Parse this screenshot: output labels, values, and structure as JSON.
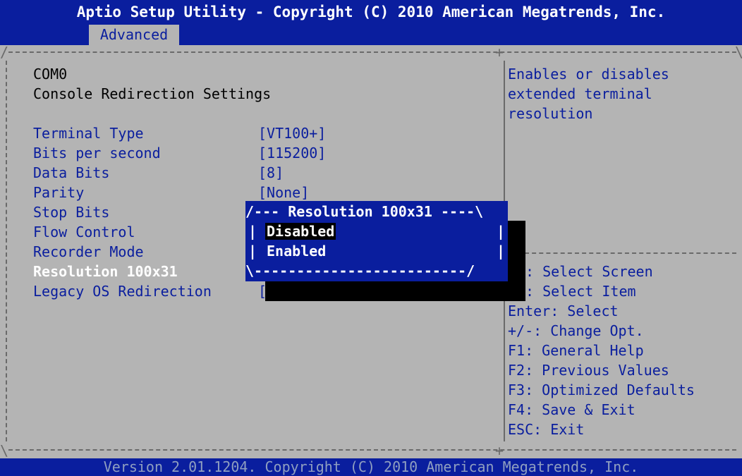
{
  "header": {
    "title": "Aptio Setup Utility - Copyright (C) 2010 American Megatrends, Inc.",
    "tab_label": "Advanced"
  },
  "footer": {
    "version_text": "Version 2.01.1204. Copyright (C) 2010 American Megatrends, Inc."
  },
  "main": {
    "heading_line1": "COM0",
    "heading_line2": "Console Redirection Settings",
    "settings": [
      {
        "label": "Terminal Type",
        "value": "[VT100+]"
      },
      {
        "label": "Bits per second",
        "value": "[115200]"
      },
      {
        "label": "Data Bits",
        "value": "[8]"
      },
      {
        "label": "Parity",
        "value": "[None]"
      },
      {
        "label": "Stop Bits",
        "value": ""
      },
      {
        "label": "Flow Control",
        "value": ""
      },
      {
        "label": "Recorder Mode",
        "value": ""
      },
      {
        "label": "Resolution 100x31",
        "value": ""
      },
      {
        "label": "Legacy OS Redirection",
        "value": "["
      }
    ]
  },
  "popup": {
    "title_line": "/--- Resolution 100x31 ----\\",
    "bottom_line": "\\-------------------------/",
    "left_bar": "|",
    "right_bar": "|",
    "options": [
      "Disabled",
      "Enabled"
    ],
    "selected_option": "Disabled"
  },
  "help_panel": {
    "lines": [
      "Enables or disables",
      "extended terminal",
      "resolution"
    ]
  },
  "keys_panel": {
    "lines": [
      ": Select Screen",
      ": Select Item",
      "Enter: Select",
      "+/-: Change Opt.",
      "F1: General Help",
      "F2: Previous Values",
      "F3: Optimized Defaults",
      "F4: Save & Exit",
      "ESC: Exit"
    ]
  },
  "colors": {
    "background": "#b4b4b4",
    "accent_blue": "#0a1e9e",
    "highlight": "#ffffff",
    "border_gray": "#6a6a6a",
    "popup_shadow": "#000000"
  }
}
